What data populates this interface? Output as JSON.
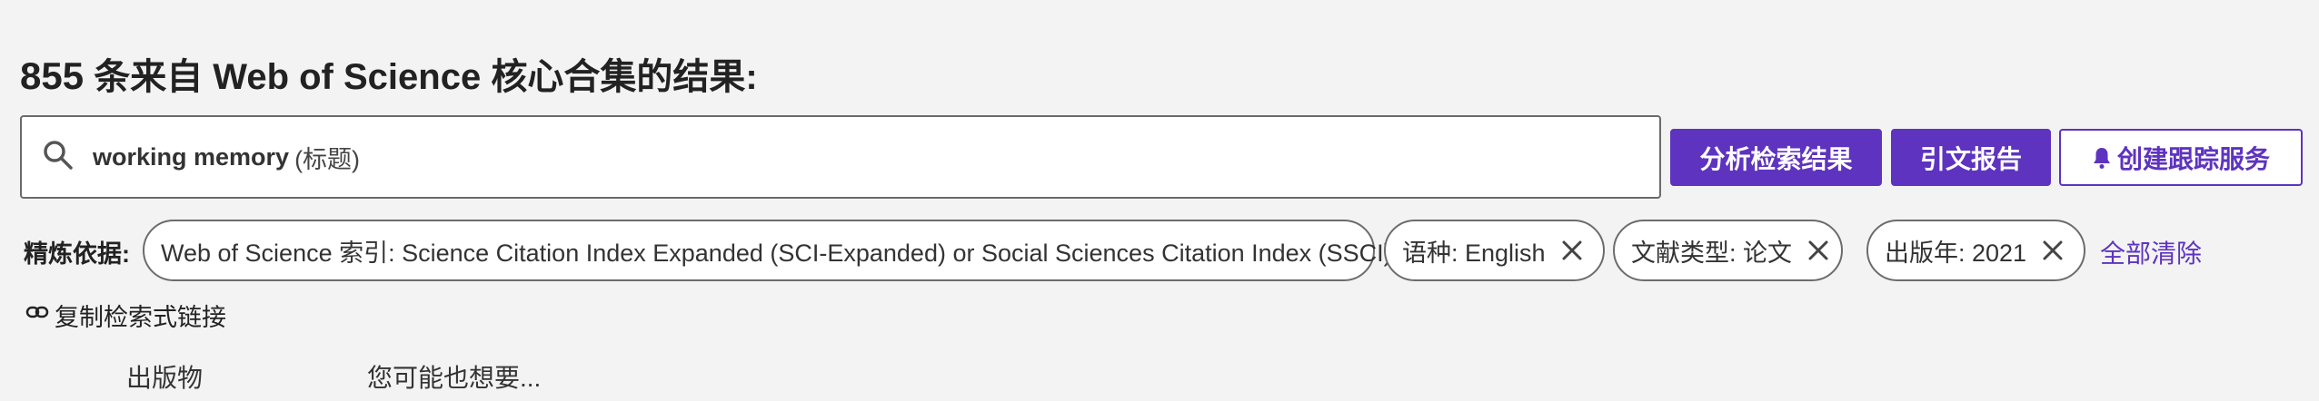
{
  "header": {
    "count": "855",
    "title_suffix": " 条来自 Web of Science 核心合集的结果:"
  },
  "search": {
    "term": "working memory",
    "field": "(标题)"
  },
  "actions": {
    "analyze": "分析检索结果",
    "citation_report": "引文报告",
    "create_alert": "创建跟踪服务"
  },
  "refine": {
    "label": "精炼依据:",
    "chips": [
      "Web of Science 索引: Science Citation Index Expanded (SCI-Expanded) or Social Sciences Citation Index (SSCI)",
      "语种: English",
      "文献类型: 论文",
      "出版年: 2021"
    ],
    "clear_all": "全部清除"
  },
  "copy_link": "复制检索式链接",
  "footer": {
    "publications": "出版物",
    "you_may_like": "您可能也想要..."
  },
  "colors": {
    "accent": "#5e33bf",
    "background": "#f3f3f3"
  },
  "icons": [
    "search-icon",
    "bell-icon",
    "close-icon",
    "link-icon"
  ]
}
